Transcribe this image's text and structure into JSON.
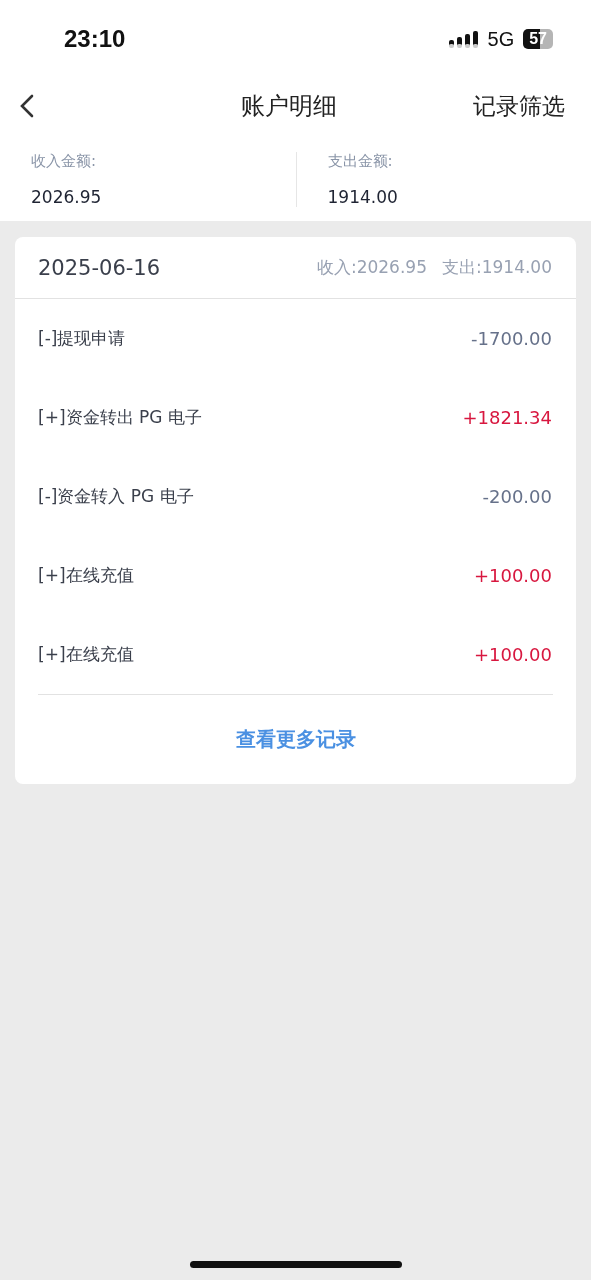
{
  "status_bar": {
    "time": "23:10",
    "network": "5G",
    "battery": "57"
  },
  "nav": {
    "title": "账户明细",
    "action": "记录筛选"
  },
  "summary": [
    {
      "label": "收入金额:",
      "value": "2026.95"
    },
    {
      "label": "支出金额:",
      "value": "1914.00"
    }
  ],
  "day": {
    "date": "2025-06-16",
    "income": "收入:2026.95",
    "expense": "支出:1914.00",
    "records": [
      {
        "title": "[-]提现申请",
        "amount": "-1700.00",
        "kind": "expense"
      },
      {
        "title": "[+]资金转出 PG 电子",
        "amount": "+1821.34",
        "kind": "income"
      },
      {
        "title": "[-]资金转入 PG 电子",
        "amount": "-200.00",
        "kind": "expense"
      },
      {
        "title": "[+]在线充值",
        "amount": "+100.00",
        "kind": "income"
      },
      {
        "title": "[+]在线充值",
        "amount": "+100.00",
        "kind": "income"
      }
    ],
    "more": "查看更多记录"
  }
}
